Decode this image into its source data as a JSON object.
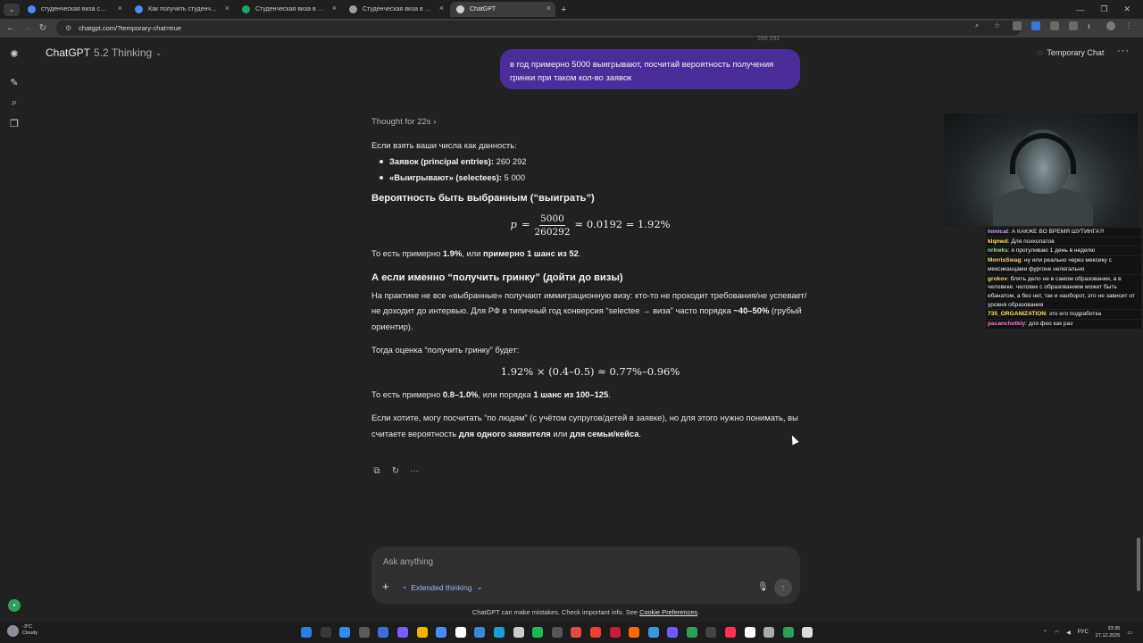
{
  "browser": {
    "tabs": [
      {
        "label": "студенческая виза сша учитыв",
        "color": "#4a8cf7"
      },
      {
        "label": "Как получить студенческую ви",
        "color": "#4a8cf7"
      },
      {
        "label": "Студенческая виза в США - кто",
        "color": "#1fa463"
      },
      {
        "label": "Студенческая виза в США: сп",
        "color": "#9aa0a6"
      },
      {
        "label": "ChatGPT",
        "color": "#cfcfcf"
      }
    ],
    "url": "chatgpt.com/?temporary-chat=true"
  },
  "header": {
    "model_name": "ChatGPT",
    "model_version": "5.2 Thinking",
    "temporary_chat_label": "Temporary Chat"
  },
  "conversation": {
    "prev_meta": "260 292",
    "user_message": "в год примерно 5000 выигрывают, посчитай вероятность получения гринки при таком кол-во заявок",
    "thought_label": "Thought for 22s",
    "intro": "Если взять ваши числа как данность:",
    "bullets": [
      {
        "bold": "Заявок (principal entries):",
        "text": " 260 292"
      },
      {
        "bold": "«Выигрывают» (selectees):",
        "text": " 5 000"
      }
    ],
    "h1": "Вероятность быть выбранным (“выиграть”)",
    "formula1": {
      "lhs": "p",
      "num": "5000",
      "den": "260292",
      "rhs": "≈ 0.0192 = 1.92%"
    },
    "p1_a": "То есть примерно ",
    "p1_b": "1.9%",
    "p1_c": ", или ",
    "p1_d": "примерно 1 шанс из 52",
    "p1_e": ".",
    "h2": "А если именно “получить гринку” (дойти до визы)",
    "p2_a": "На практике не все «выбранные» получают иммиграционную визу: кто-то не проходит требования/не успевает/не доходит до интервью. Для РФ в типичный год конверсия “selectee → виза” часто порядка ",
    "p2_b": "~40–50%",
    "p2_c": " (грубый ориентир).",
    "p3": "Тогда оценка “получить гринку” будет:",
    "formula2": "1.92% × (0.4–0.5) ≈ 0.77%–0.96%",
    "p4_a": "То есть примерно ",
    "p4_b": "0.8–1.0%",
    "p4_c": ", или порядка ",
    "p4_d": "1 шанс из 100–125",
    "p4_e": ".",
    "p5_a": "Если хотите, могу посчитать “по людям” (с учётом супругов/детей в заявке), но для этого нужно понимать, вы считаете вероятность ",
    "p5_b": "для одного заявителя",
    "p5_c": " или ",
    "p5_d": "для семьи/кейса",
    "p5_e": "."
  },
  "composer": {
    "placeholder": "Ask anything",
    "extended_thinking": "Extended thinking"
  },
  "footer": {
    "disclaimer": "ChatGPT can make mistakes. Check important info. See ",
    "link": "Cookie Preferences",
    "end": "."
  },
  "stream_chat": [
    {
      "user": "himicat",
      "color": "#c7a4ff",
      "text": "А КАКЖЕ ВО ВРЕМЯ ШУТИНГА?!"
    },
    {
      "user": "klqnwd",
      "color": "#ffe066",
      "text": "Для психопатов"
    },
    {
      "user": "nrkwks",
      "color": "#8ee08e",
      "text": "я прогуливаю 1 день в неделю"
    },
    {
      "user": "MorrisSwag",
      "color": "#ffd27a",
      "text": "ну или реально через мексику с мексиканцами фургоне нелегально"
    },
    {
      "user": "grokov",
      "color": "#ffd27a",
      "text": "блять дело не в самом образовании, а в человеке. человек с образованием может быть ебанатом, а без нет, так и наоборот, это не зависит от уровня образования"
    },
    {
      "user": "735_ORGANIZATION",
      "color": "#ffe066",
      "text": "это его подработка"
    },
    {
      "user": "pacanchotkiy",
      "color": "#ff7ad9",
      "text": "для фео как раз"
    }
  ],
  "taskbar": {
    "temperature": "-3°C",
    "weather": "Cloudy",
    "lang": "РУС",
    "time": "23:35",
    "date": "27.12.2025",
    "icons": [
      "#2b7de9",
      "#3a3a3a",
      "#2d8cf0",
      "#5a5a5a",
      "#3c6fd6",
      "#7a5cff",
      "#f0b400",
      "#4a8cf7",
      "#ffffff",
      "#3a88d8",
      "#1b9ed8",
      "#cccccc",
      "#1db954",
      "#555555",
      "#e24a3b",
      "#ea4335",
      "#c51e3a",
      "#ff6a00",
      "#3a9ad9",
      "#6b5bff",
      "#2e9e5b",
      "#444444",
      "#ff3355",
      "#ffffff",
      "#aaaaaa",
      "#2e9e5b",
      "#dddddd"
    ]
  }
}
